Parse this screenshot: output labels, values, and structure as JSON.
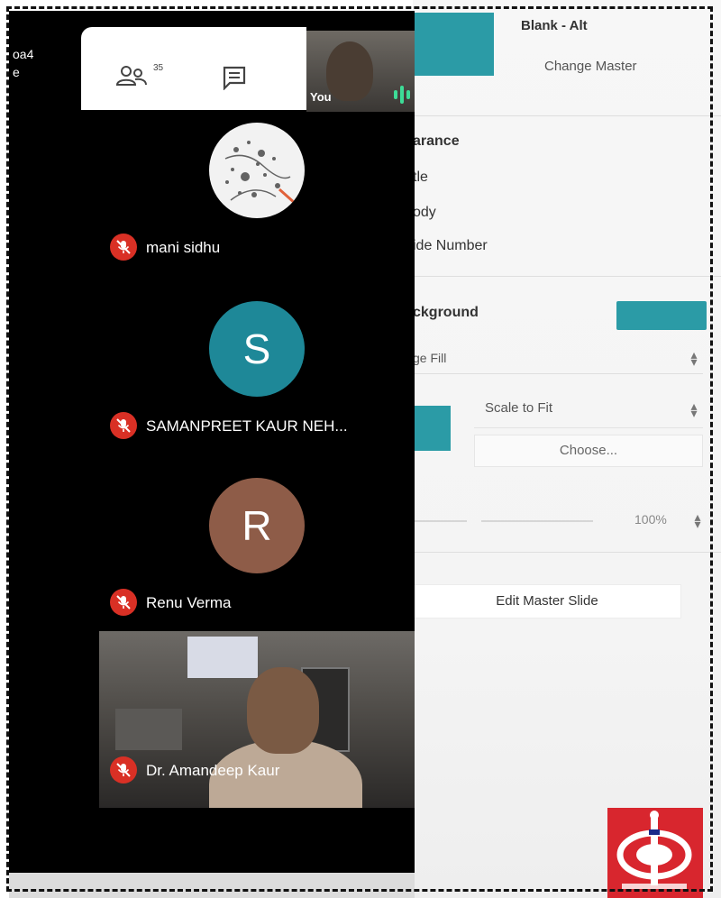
{
  "meeting": {
    "title_line1": "oa4",
    "title_line2": "e",
    "toolbar": {
      "people_icon": "people-icon",
      "people_count": "35",
      "chat_icon": "chat-icon"
    },
    "self_view": {
      "label": "You",
      "speaking_icon": "audio-level-icon"
    },
    "participants": [
      {
        "name": "mani sidhu",
        "avatar_type": "photo",
        "muted": true
      },
      {
        "name": "SAMANPREET KAUR NEH...",
        "avatar_letter": "S",
        "avatar_color": "#1e8898",
        "muted": true
      },
      {
        "name": "Renu Verma",
        "avatar_letter": "R",
        "avatar_color": "#8e5c48",
        "muted": true
      },
      {
        "name": "Dr. Amandeep Kaur",
        "avatar_type": "video",
        "muted": true
      }
    ],
    "mute_icon": "mic-off-icon",
    "mute_color": "#d93025"
  },
  "inspector": {
    "master_name": "Blank - Alt",
    "change_master": "Change Master",
    "appearance_rows": [
      "arance",
      "tle",
      "ody",
      "ide Number"
    ],
    "background_title": "ckground",
    "background_color": "#2b9ba6",
    "fill_type": "ge Fill",
    "scale_option": "Scale to Fit",
    "choose_label": "Choose...",
    "opacity_value": "100%",
    "edit_master_label": "Edit Master Slide",
    "logo_icon": "institution-logo"
  }
}
